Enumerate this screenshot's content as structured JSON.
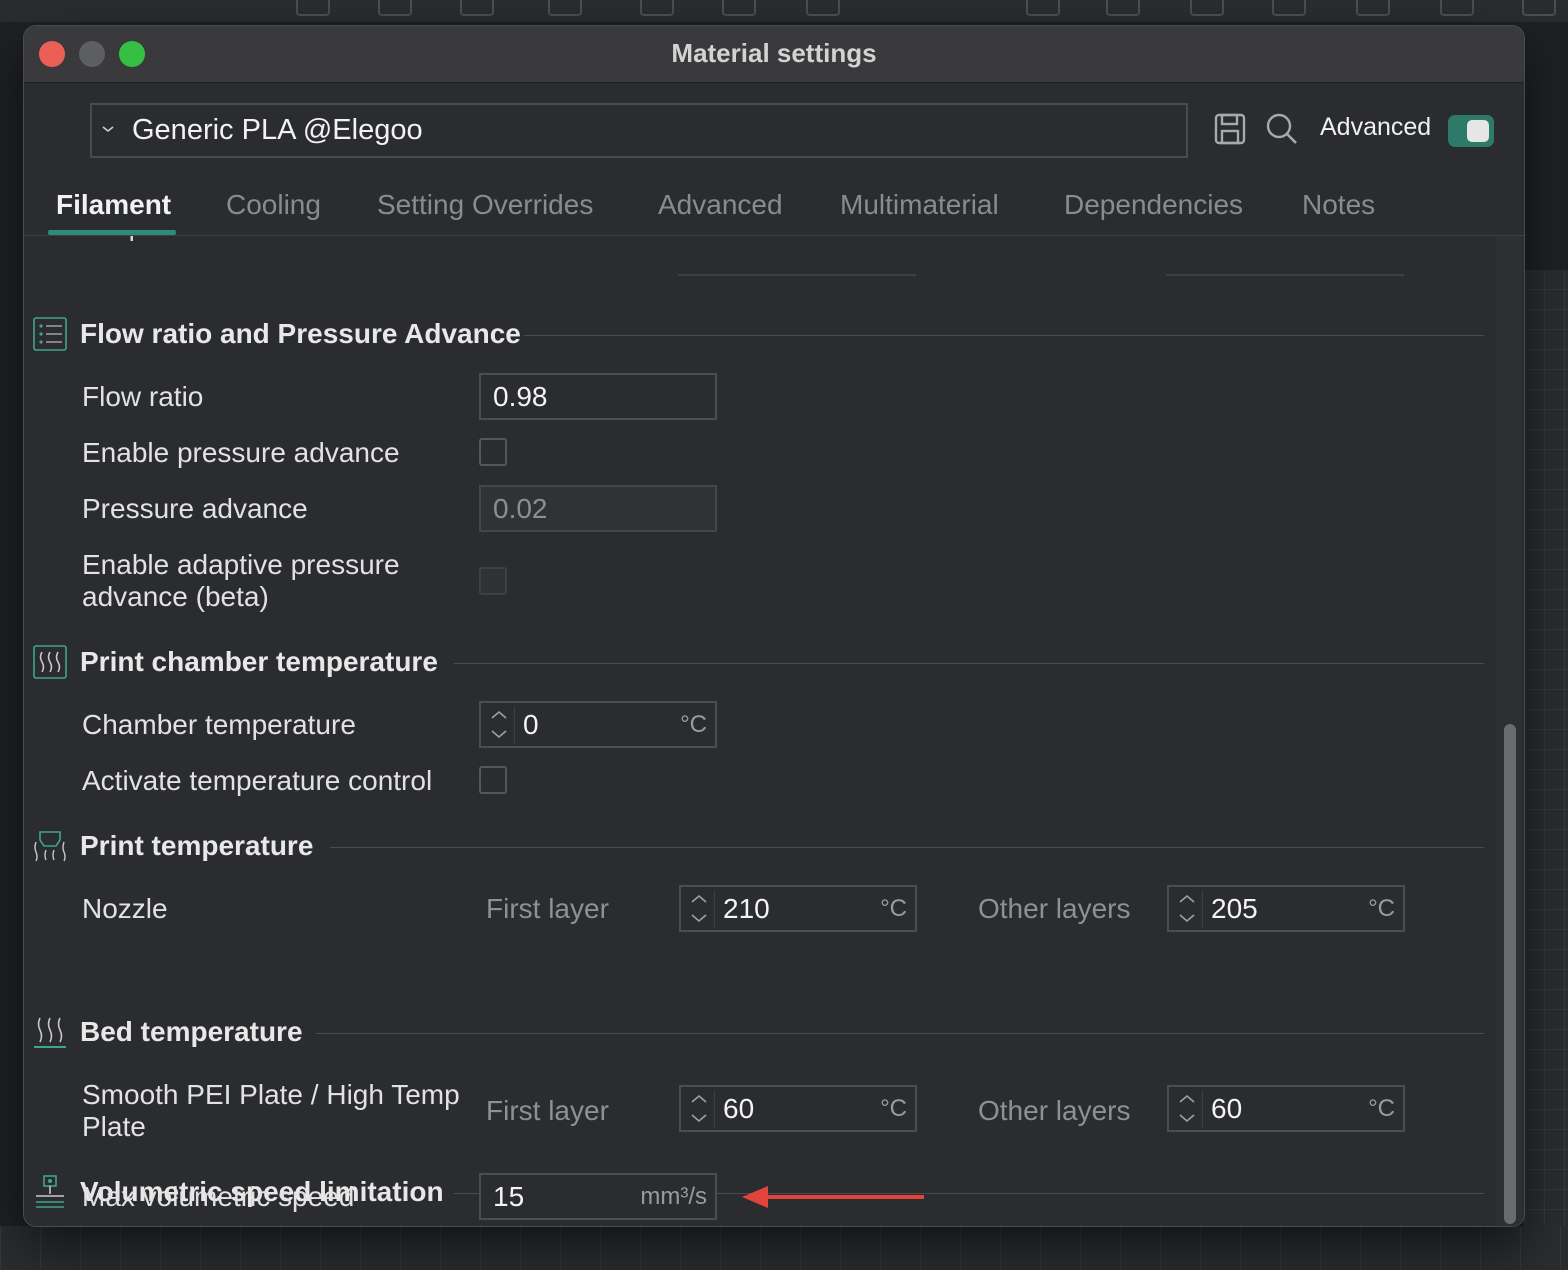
{
  "window": {
    "title": "Material settings"
  },
  "preset": {
    "selected": "Generic PLA @Elegoo"
  },
  "toolbar": {
    "advanced_label": "Advanced",
    "advanced_enabled": true
  },
  "tabs": [
    {
      "label": "Filament",
      "active": true
    },
    {
      "label": "Cooling"
    },
    {
      "label": "Setting Overrides"
    },
    {
      "label": "Advanced"
    },
    {
      "label": "Multimaterial"
    },
    {
      "label": "Dependencies"
    },
    {
      "label": "Notes"
    }
  ],
  "cut_off_label": "temperature",
  "flow": {
    "title": "Flow ratio and Pressure Advance",
    "flow_ratio_label": "Flow ratio",
    "flow_ratio_value": "0.98",
    "enable_pa_label": "Enable pressure advance",
    "enable_pa_checked": false,
    "pa_label": "Pressure advance",
    "pa_value": "0.02",
    "adaptive_pa_label_1": "Enable adaptive pressure",
    "adaptive_pa_label_2": "advance (beta)",
    "adaptive_pa_checked": false
  },
  "chamber": {
    "title": "Print chamber temperature",
    "temp_label": "Chamber temperature",
    "temp_value": "0",
    "unit": "°C",
    "activate_label": "Activate temperature control",
    "activate_checked": false
  },
  "print_temp": {
    "title": "Print temperature",
    "nozzle_label": "Nozzle",
    "first_layer_label": "First layer",
    "first_layer_value": "210",
    "other_layers_label": "Other layers",
    "other_layers_value": "205",
    "unit": "°C"
  },
  "bed_temp": {
    "title": "Bed temperature",
    "plate_label_1": "Smooth PEI Plate / High Temp",
    "plate_label_2": "Plate",
    "first_layer_label": "First layer",
    "first_layer_value": "60",
    "other_layers_label": "Other layers",
    "other_layers_value": "60",
    "unit": "°C"
  },
  "volumetric": {
    "title": "Volumetric speed limitation",
    "max_label": "Max volumetric speed",
    "max_value": "15",
    "unit": "mm³/s"
  },
  "colors": {
    "accent": "#2d8c79",
    "annotation_arrow": "#e0443a",
    "icon_teal": "#3fa38e"
  },
  "icons": [
    "chevron-down-icon",
    "save-icon",
    "search-icon",
    "list-icon",
    "chamber-heat-icon",
    "nozzle-heat-icon",
    "bed-heat-icon",
    "volumetric-icon",
    "spinner-icon"
  ]
}
